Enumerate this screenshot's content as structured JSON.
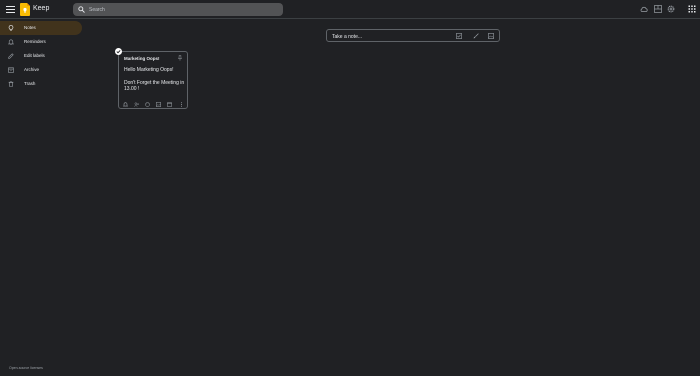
{
  "header": {
    "app_name": "Keep",
    "search": {
      "placeholder": "Search",
      "value": ""
    },
    "icons": [
      "menu-icon",
      "keep-logo",
      "search-icon",
      "cloud-icon",
      "list-view-icon",
      "settings-icon",
      "apps-grid-icon"
    ]
  },
  "sidebar": {
    "items": [
      {
        "label": "Notes",
        "icon": "lightbulb-icon",
        "active": true
      },
      {
        "label": "Reminders",
        "icon": "bell-icon"
      },
      {
        "label": "Edit labels",
        "icon": "pencil-icon"
      },
      {
        "label": "Archive",
        "icon": "archive-icon"
      },
      {
        "label": "Trash",
        "icon": "trash-icon"
      }
    ]
  },
  "take_note": {
    "placeholder": "Take a note...",
    "icons": [
      "checkbox-icon",
      "brush-icon",
      "image-icon"
    ]
  },
  "note": {
    "title": "Marketing Oops!",
    "lines": [
      "Hello Marketing Oops!",
      "Don't Forget the Meeting in 13.00 !"
    ],
    "tool_icons": [
      "bell-icon",
      "collaborator-icon",
      "palette-icon",
      "image-icon",
      "archive-icon",
      "more-icon"
    ]
  },
  "footer": {
    "link": "Open-source licenses"
  },
  "colors": {
    "background": "#202124",
    "active_nav": "#41331c",
    "search_bg": "#525355",
    "logo": "#fbbc04",
    "border": "#5f6368"
  }
}
